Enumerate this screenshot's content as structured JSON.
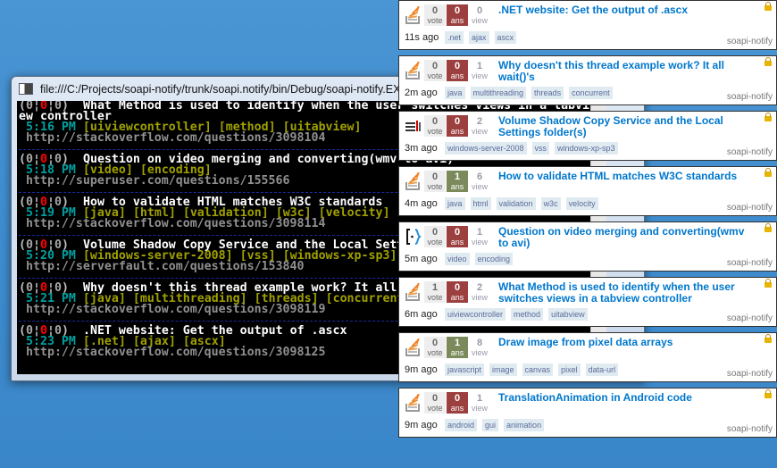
{
  "console": {
    "title": "file:///C:/Projects/soapi-notify/trunk/soapi.notify/bin/Debug/soapi-notify.EXE",
    "entries": [
      {
        "votes": "0",
        "answers": "0",
        "views": "0",
        "title": "What Method is used to identify when the user switches views in a tabview controller",
        "time": "5:16 PM",
        "tags": [
          "uiviewcontroller",
          "method",
          "uitabview"
        ],
        "url": "http://stackoverflow.com/questions/3098104"
      },
      {
        "votes": "0",
        "answers": "0",
        "views": "0",
        "title": "Question on video merging and converting(wmv to avi)",
        "time": "5:18 PM",
        "tags": [
          "video",
          "encoding"
        ],
        "url": "http://superuser.com/questions/155566"
      },
      {
        "votes": "0",
        "answers": "0",
        "views": "0",
        "title": "How to validate HTML matches W3C standards",
        "time": "5:19 PM",
        "tags": [
          "java",
          "html",
          "validation",
          "w3c",
          "velocity"
        ],
        "url": "http://stackoverflow.com/questions/3098114"
      },
      {
        "votes": "0",
        "answers": "0",
        "views": "0",
        "title": "Volume Shadow Copy Service and the Local Settings folder(s)",
        "time": "5:20 PM",
        "tags": [
          "windows-server-2008",
          "vss",
          "windows-xp-sp3"
        ],
        "url": "http://serverfault.com/questions/153840"
      },
      {
        "votes": "0",
        "answers": "0",
        "views": "0",
        "title": "Why doesn't this thread example work? It all wait()'s",
        "time": "5:21 PM",
        "tags": [
          "java",
          "multithreading",
          "threads",
          "concurrent"
        ],
        "url": "http://stackoverflow.com/questions/3098119"
      },
      {
        "votes": "0",
        "answers": "0",
        "views": "0",
        "title": ".NET website: Get the output of .ascx",
        "time": "5:23 PM",
        "tags": [
          ".net",
          "ajax",
          "ascx"
        ],
        "url": "http://stackoverflow.com/questions/3098125"
      }
    ],
    "cursor": "_"
  },
  "notifications": {
    "vote_label": "vote",
    "answer_label": "ans",
    "view_label": "view",
    "source": "soapi-notify",
    "colors": {
      "answered": "#7a8a5a",
      "unanswered": "#9b3f3f",
      "link": "#0077cc"
    },
    "cards": [
      {
        "site": "stackoverflow",
        "votes": "0",
        "answers": "0",
        "views": "0",
        "title": ".NET website: Get the output of .ascx",
        "ago": "11s ago",
        "tags": [
          ".net",
          "ajax",
          "ascx"
        ]
      },
      {
        "site": "stackoverflow",
        "votes": "0",
        "answers": "0",
        "views": "1",
        "title": "Why doesn't this thread example work? It all wait()'s",
        "ago": "2m ago",
        "tags": [
          "java",
          "multithreading",
          "threads",
          "concurrent"
        ]
      },
      {
        "site": "serverfault",
        "votes": "0",
        "answers": "0",
        "views": "2",
        "title": "Volume Shadow Copy Service and the Local Settings folder(s)",
        "ago": "3m ago",
        "tags": [
          "windows-server-2008",
          "vss",
          "windows-xp-sp3"
        ]
      },
      {
        "site": "stackoverflow",
        "votes": "0",
        "answers": "1",
        "views": "6",
        "title": "How to validate HTML matches W3C standards",
        "ago": "4m ago",
        "tags": [
          "java",
          "html",
          "validation",
          "w3c",
          "velocity"
        ]
      },
      {
        "site": "superuser",
        "votes": "0",
        "answers": "0",
        "views": "1",
        "title": "Question on video merging and converting(wmv to avi)",
        "ago": "5m ago",
        "tags": [
          "video",
          "encoding"
        ]
      },
      {
        "site": "stackoverflow",
        "votes": "1",
        "answers": "0",
        "views": "2",
        "title": "What Method is used to identify when the user switches views in a tabview controller",
        "ago": "6m ago",
        "tags": [
          "uiviewcontroller",
          "method",
          "uitabview"
        ]
      },
      {
        "site": "stackoverflow",
        "votes": "0",
        "answers": "1",
        "views": "8",
        "title": "Draw image from pixel data arrays",
        "ago": "9m ago",
        "tags": [
          "javascript",
          "image",
          "canvas",
          "pixel",
          "data-url"
        ]
      },
      {
        "site": "stackoverflow",
        "votes": "0",
        "answers": "0",
        "views": "1",
        "title": "TranslationAnimation in Android code",
        "ago": "9m ago",
        "tags": [
          "android",
          "gui",
          "animation"
        ]
      }
    ]
  }
}
